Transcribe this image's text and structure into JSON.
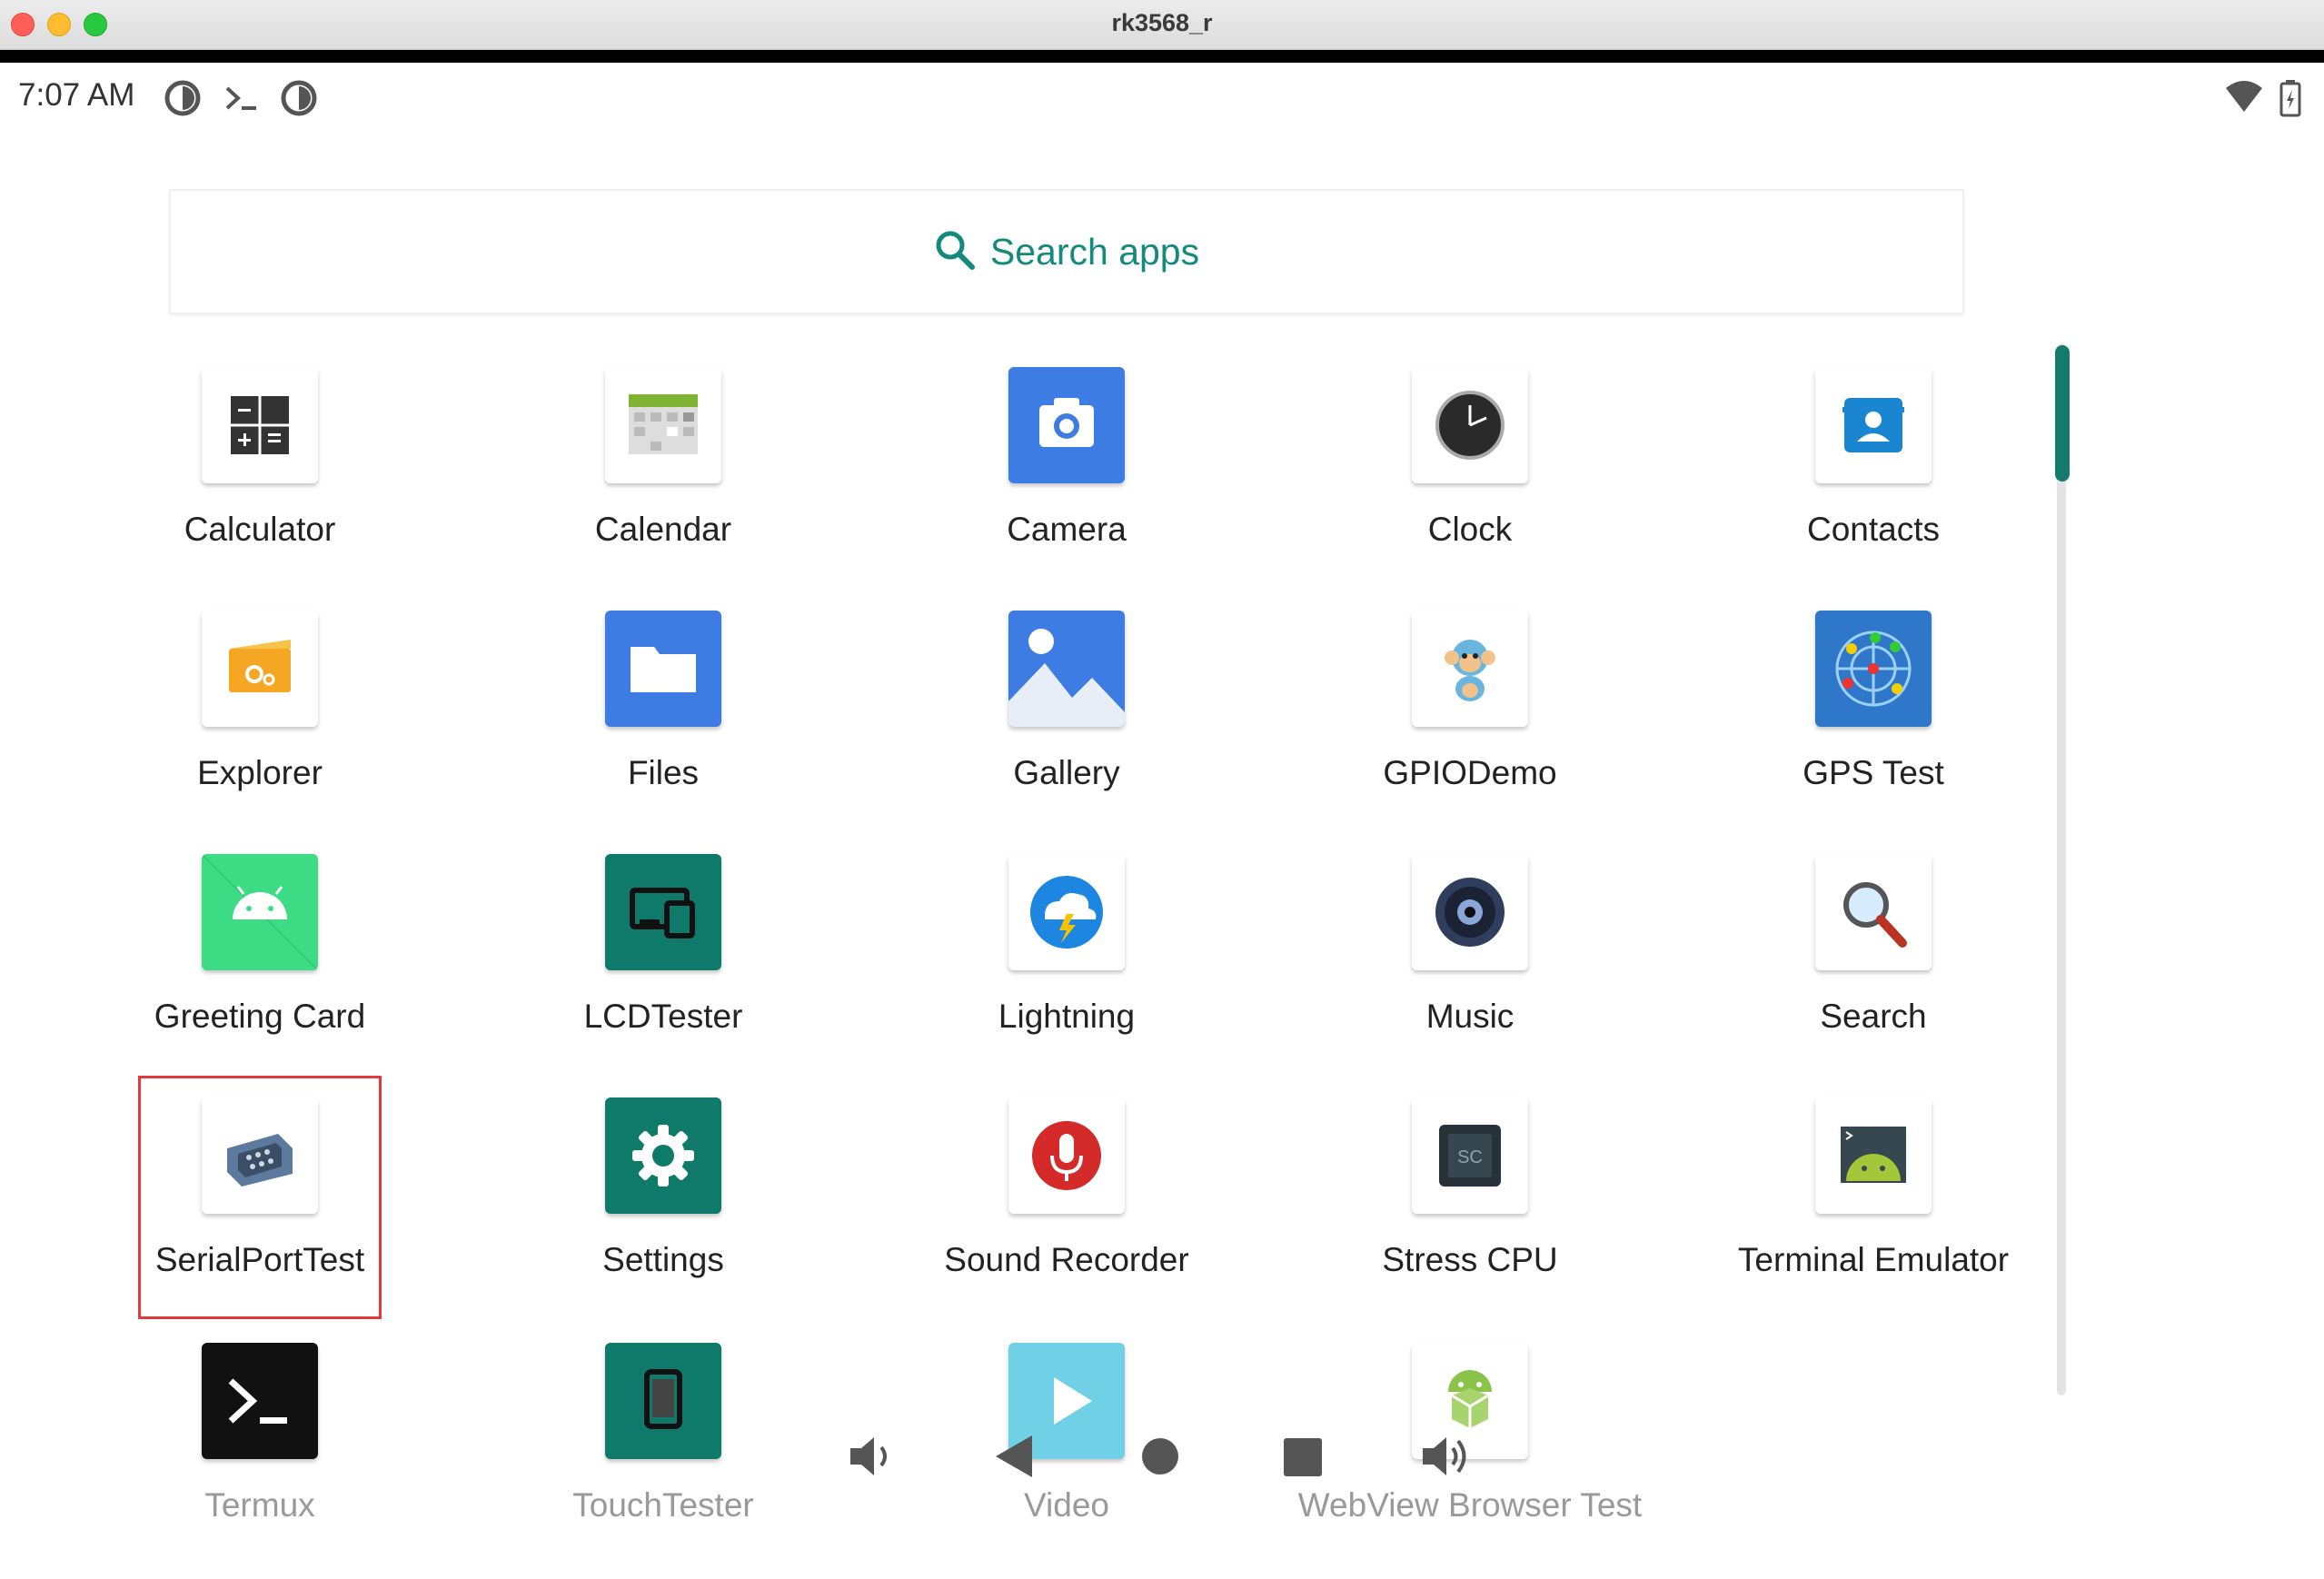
{
  "window": {
    "title": "rk3568_r"
  },
  "status_bar": {
    "time": "7:07 AM"
  },
  "search": {
    "label": "Search apps"
  },
  "apps": [
    {
      "label": "Calculator"
    },
    {
      "label": "Calendar"
    },
    {
      "label": "Camera"
    },
    {
      "label": "Clock"
    },
    {
      "label": "Contacts"
    },
    {
      "label": "Explorer"
    },
    {
      "label": "Files"
    },
    {
      "label": "Gallery"
    },
    {
      "label": "GPIODemo"
    },
    {
      "label": "GPS Test"
    },
    {
      "label": "Greeting Card"
    },
    {
      "label": "LCDTester"
    },
    {
      "label": "Lightning"
    },
    {
      "label": "Music"
    },
    {
      "label": "Search"
    },
    {
      "label": "SerialPortTest"
    },
    {
      "label": "Settings"
    },
    {
      "label": "Sound Recorder"
    },
    {
      "label": "Stress CPU"
    },
    {
      "label": "Terminal Emulator"
    },
    {
      "label": "Termux"
    },
    {
      "label": "TouchTester"
    },
    {
      "label": "Video"
    },
    {
      "label": "WebView Browser Test"
    }
  ],
  "selected_app": "SerialPortTest",
  "colors": {
    "accent": "#148a7c",
    "highlight": "#e23a3a"
  }
}
